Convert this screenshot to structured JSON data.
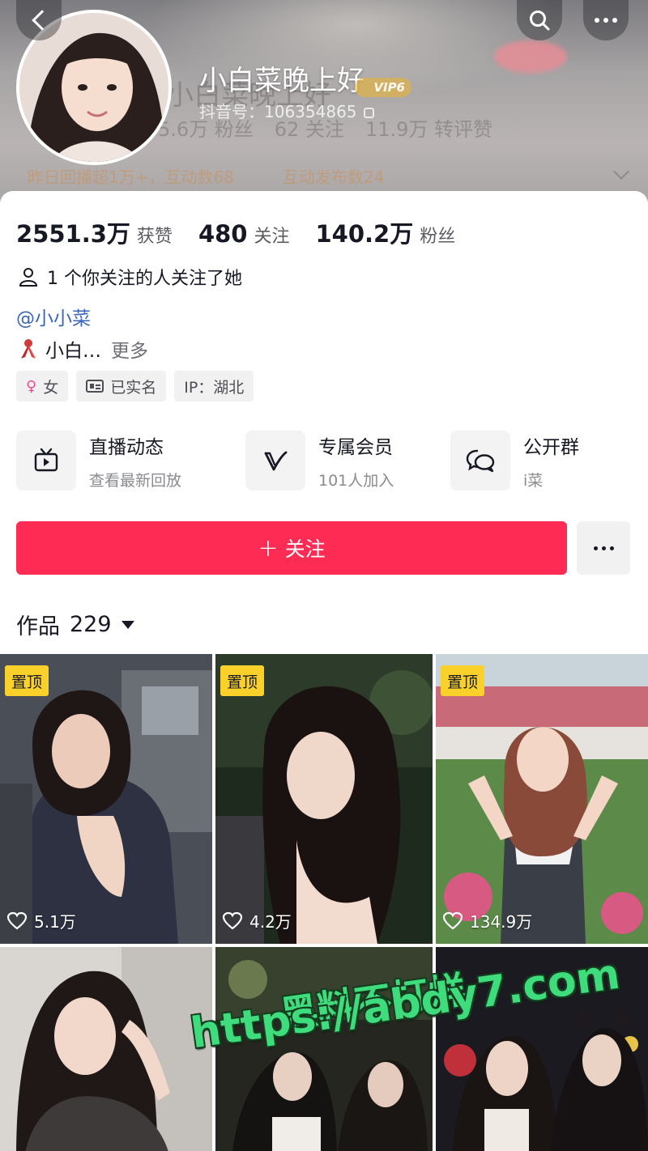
{
  "header": {
    "display_name": "小白菜晚上好",
    "ghost_name": "小白菜晚上好",
    "vip_label": "VIP6",
    "id_line": "抖音号：106354865",
    "ghost_stats": [
      "5.6万 粉丝",
      "62 关注",
      "11.9万 转评赞"
    ],
    "ghost_row2": [
      "昨日回播超1万+，互动数68",
      "互动发布数24"
    ]
  },
  "stats": [
    {
      "value": "2551.3万",
      "label": "获赞"
    },
    {
      "value": "480",
      "label": "关注"
    },
    {
      "value": "140.2万",
      "label": "粉丝"
    }
  ],
  "mutual_text": "1 个你关注的人关注了她",
  "mention": "@小小菜",
  "bio": {
    "text": "小白…",
    "more": "更多"
  },
  "tags": {
    "gender": "女",
    "verified": "已实名",
    "ip": "IP：湖北"
  },
  "features": [
    {
      "title": "直播动态",
      "subtitle": "查看最新回放",
      "icon": "tv-icon"
    },
    {
      "title": "专属会员",
      "subtitle": "101人加入",
      "icon": "v-icon"
    },
    {
      "title": "公开群",
      "subtitle": "i菜",
      "icon": "chat-icon"
    }
  ],
  "follow_label": "关注",
  "works": {
    "label": "作品",
    "count": "229"
  },
  "videos": [
    {
      "pinned": "置顶",
      "likes": "5.1万"
    },
    {
      "pinned": "置顶",
      "likes": "4.2万"
    },
    {
      "pinned": "置顶",
      "likes": "134.9万"
    },
    {
      "pinned": "",
      "likes": ""
    },
    {
      "pinned": "",
      "likes": ""
    },
    {
      "pinned": "",
      "likes": ""
    }
  ],
  "watermark": {
    "line1": "黑料不打烊",
    "line2": "https://abdy7.com"
  },
  "colors": {
    "accent": "#fe2c55",
    "pin": "#f9d12a",
    "link": "#3a66b8",
    "watermark": "#3fdc7e"
  }
}
